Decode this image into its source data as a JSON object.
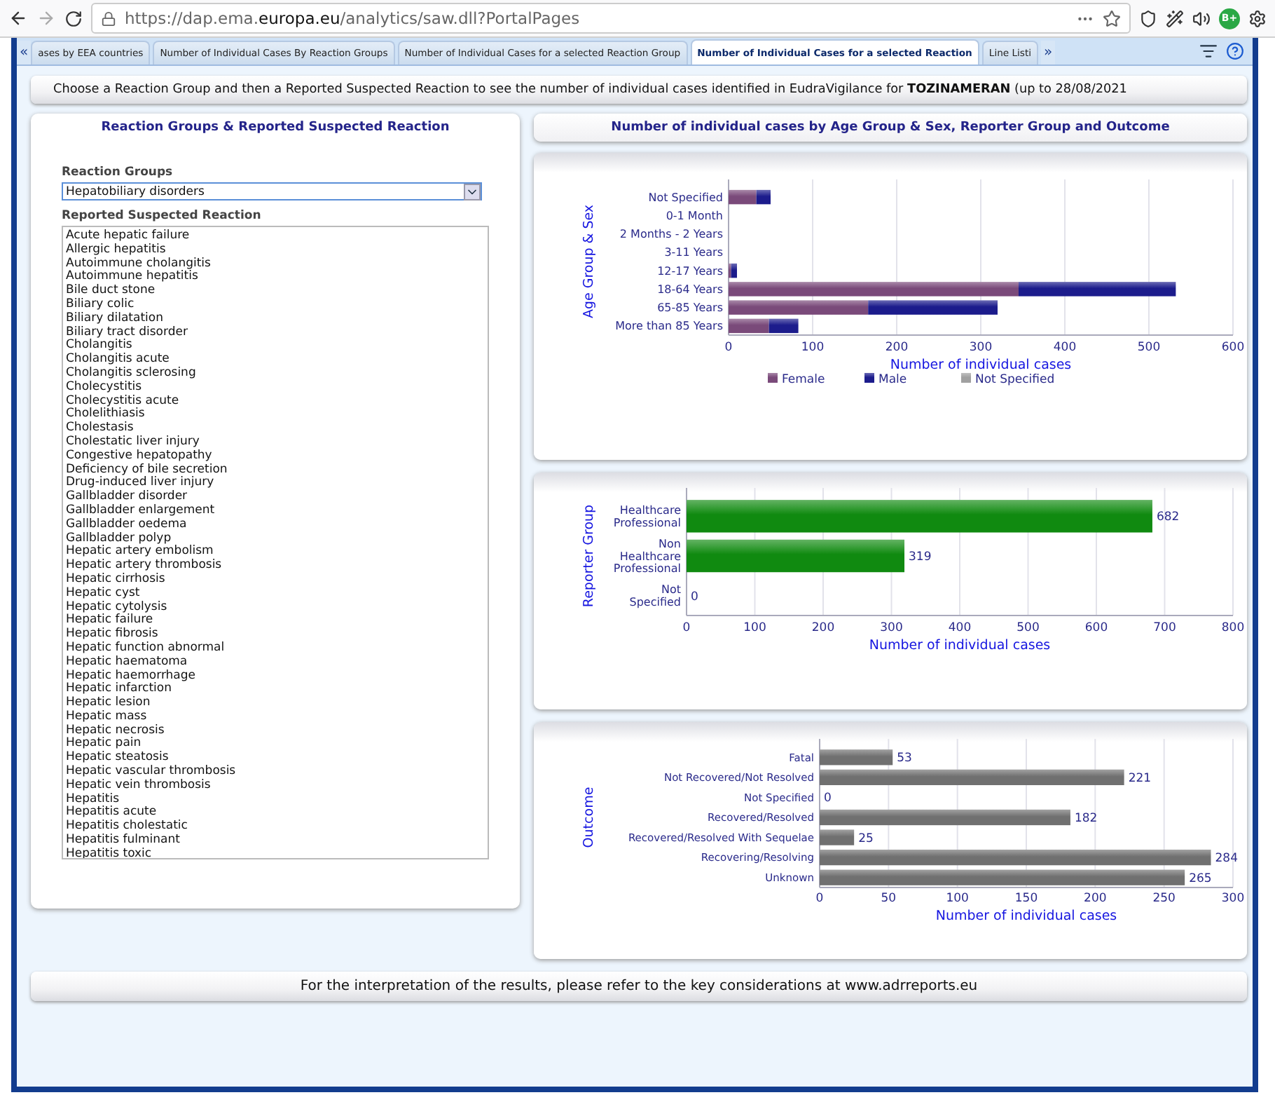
{
  "browser": {
    "url": "https://dap.ema.**europa.eu**/analytics/saw.dll?PortalPages",
    "extension_badge": "B+"
  },
  "tab_scroll": {
    "left": "«",
    "right": "»"
  },
  "tabs": [
    {
      "label": "ases by EEA countries",
      "selected": false
    },
    {
      "label": "Number of Individual Cases By Reaction Groups",
      "selected": false
    },
    {
      "label": "Number of Individual Cases for a selected Reaction Group",
      "selected": false
    },
    {
      "label": "Number of Individual Cases for a selected Reaction",
      "selected": true
    },
    {
      "label": "Line Listi",
      "selected": false
    }
  ],
  "banner": "Choose a Reaction Group and then a Reported Suspected Reaction to see the number of individual cases identified in EudraVigilance for **TOZINAMERAN** (up to 28/08/2021",
  "left_panel": {
    "title": "Reaction Groups & Reported Suspected Reaction",
    "reaction_groups": {
      "label": "Reaction Groups",
      "value": "Hepatobiliary disorders"
    },
    "reactions": {
      "label": "Reported Suspected Reaction",
      "items": [
        {
          "label": "Acute hepatic failure",
          "selected": false
        },
        {
          "label": "Allergic hepatitis",
          "selected": false
        },
        {
          "label": "Autoimmune cholangitis",
          "selected": false
        },
        {
          "label": "Autoimmune hepatitis",
          "selected": false
        },
        {
          "label": "Bile duct stone",
          "selected": false
        },
        {
          "label": "Biliary colic",
          "selected": false
        },
        {
          "label": "Biliary dilatation",
          "selected": false
        },
        {
          "label": "Biliary tract disorder",
          "selected": false
        },
        {
          "label": "Cholangitis",
          "selected": false
        },
        {
          "label": "Cholangitis acute",
          "selected": false
        },
        {
          "label": "Cholangitis sclerosing",
          "selected": false
        },
        {
          "label": "Cholecystitis",
          "selected": false
        },
        {
          "label": "Cholecystitis acute",
          "selected": false
        },
        {
          "label": "Cholelithiasis",
          "selected": false
        },
        {
          "label": "Cholestasis",
          "selected": false
        },
        {
          "label": "Cholestatic liver injury",
          "selected": false
        },
        {
          "label": "Congestive hepatopathy",
          "selected": false
        },
        {
          "label": "Deficiency of bile secretion",
          "selected": false
        },
        {
          "label": "Drug-induced liver injury",
          "selected": false
        },
        {
          "label": "Gallbladder disorder",
          "selected": false
        },
        {
          "label": "Gallbladder enlargement",
          "selected": false
        },
        {
          "label": "Gallbladder oedema",
          "selected": false
        },
        {
          "label": "Gallbladder polyp",
          "selected": false
        },
        {
          "label": "Hepatic artery embolism",
          "selected": false
        },
        {
          "label": "Hepatic artery thrombosis",
          "selected": false
        },
        {
          "label": "Hepatic cirrhosis",
          "selected": false
        },
        {
          "label": "Hepatic cyst",
          "selected": false
        },
        {
          "label": "Hepatic cytolysis",
          "selected": false
        },
        {
          "label": "Hepatic failure",
          "selected": false
        },
        {
          "label": "Hepatic fibrosis",
          "selected": false
        },
        {
          "label": "Hepatic function abnormal",
          "selected": false
        },
        {
          "label": "Hepatic haematoma",
          "selected": false
        },
        {
          "label": "Hepatic haemorrhage",
          "selected": false
        },
        {
          "label": "Hepatic infarction",
          "selected": false
        },
        {
          "label": "Hepatic lesion",
          "selected": false
        },
        {
          "label": "Hepatic mass",
          "selected": false
        },
        {
          "label": "Hepatic necrosis",
          "selected": false
        },
        {
          "label": "Hepatic pain",
          "selected": false
        },
        {
          "label": "Hepatic steatosis",
          "selected": false
        },
        {
          "label": "Hepatic vascular thrombosis",
          "selected": false
        },
        {
          "label": "Hepatic vein thrombosis",
          "selected": false
        },
        {
          "label": "Hepatitis",
          "selected": false
        },
        {
          "label": "Hepatitis acute",
          "selected": false
        },
        {
          "label": "Hepatitis cholestatic",
          "selected": false
        },
        {
          "label": "Hepatitis fulminant",
          "selected": false
        },
        {
          "label": "Hepatitis toxic",
          "selected": false
        }
      ]
    }
  },
  "right_header": "Number of individual cases by Age Group & Sex, Reporter Group and Outcome",
  "charts": [
    {
      "chart_data": {
        "type": "bar",
        "orientation": "horizontal",
        "stacked": true,
        "xlabel": "Number of individual cases",
        "ylabel": "Age Group & Sex",
        "categories": [
          "Not Specified",
          "0-1 Month",
          "2 Months - 2 Years",
          "3-11 Years",
          "12-17 Years",
          "18-64 Years",
          "65-85 Years",
          "More than 85 Years"
        ],
        "series": [
          {
            "name": "Female",
            "color": "#7a4a7a",
            "values": [
              33,
              0,
              0,
              0,
              3,
              345,
              166,
              48
            ]
          },
          {
            "name": "Male",
            "color": "#1c1c8c",
            "values": [
              17,
              0,
              0,
              0,
              7,
              187,
              154,
              35
            ]
          },
          {
            "name": "Not Specified",
            "color": "#a0a0a0",
            "values": [
              0,
              0,
              0,
              0,
              0,
              0,
              0,
              0
            ]
          }
        ],
        "xlim": [
          0,
          600
        ],
        "xticks": [
          0,
          100,
          200,
          300,
          400,
          500,
          600
        ],
        "grid": true,
        "legend": true
      }
    },
    {
      "chart_data": {
        "type": "bar",
        "orientation": "horizontal",
        "xlabel": "Number of individual cases",
        "ylabel": "Reporter Group",
        "data_labels": true,
        "categories": [
          "Healthcare Professional",
          "Non Healthcare Professional",
          "Not Specified"
        ],
        "series": [
          {
            "color": "#108a10",
            "values": [
              682,
              319,
              0
            ]
          }
        ],
        "xlim": [
          0,
          800
        ],
        "xticks": [
          0,
          100,
          200,
          300,
          400,
          500,
          600,
          700,
          800
        ],
        "grid": true
      }
    },
    {
      "chart_data": {
        "type": "bar",
        "orientation": "horizontal",
        "xlabel": "Number of individual cases",
        "ylabel": "Outcome",
        "data_labels": true,
        "categories": [
          "Fatal",
          "Not Recovered/Not Resolved",
          "Not Specified",
          "Recovered/Resolved",
          "Recovered/Resolved With Sequelae",
          "Recovering/Resolving",
          "Unknown"
        ],
        "series": [
          {
            "color": "#707070",
            "values": [
              53,
              221,
              0,
              182,
              25,
              284,
              265
            ]
          }
        ],
        "xlim": [
          0,
          300
        ],
        "xticks": [
          0,
          50,
          100,
          150,
          200,
          250,
          300
        ],
        "grid": true
      }
    }
  ],
  "footer": "For the interpretation of the results, please refer to the key considerations at www.adrreports.eu"
}
